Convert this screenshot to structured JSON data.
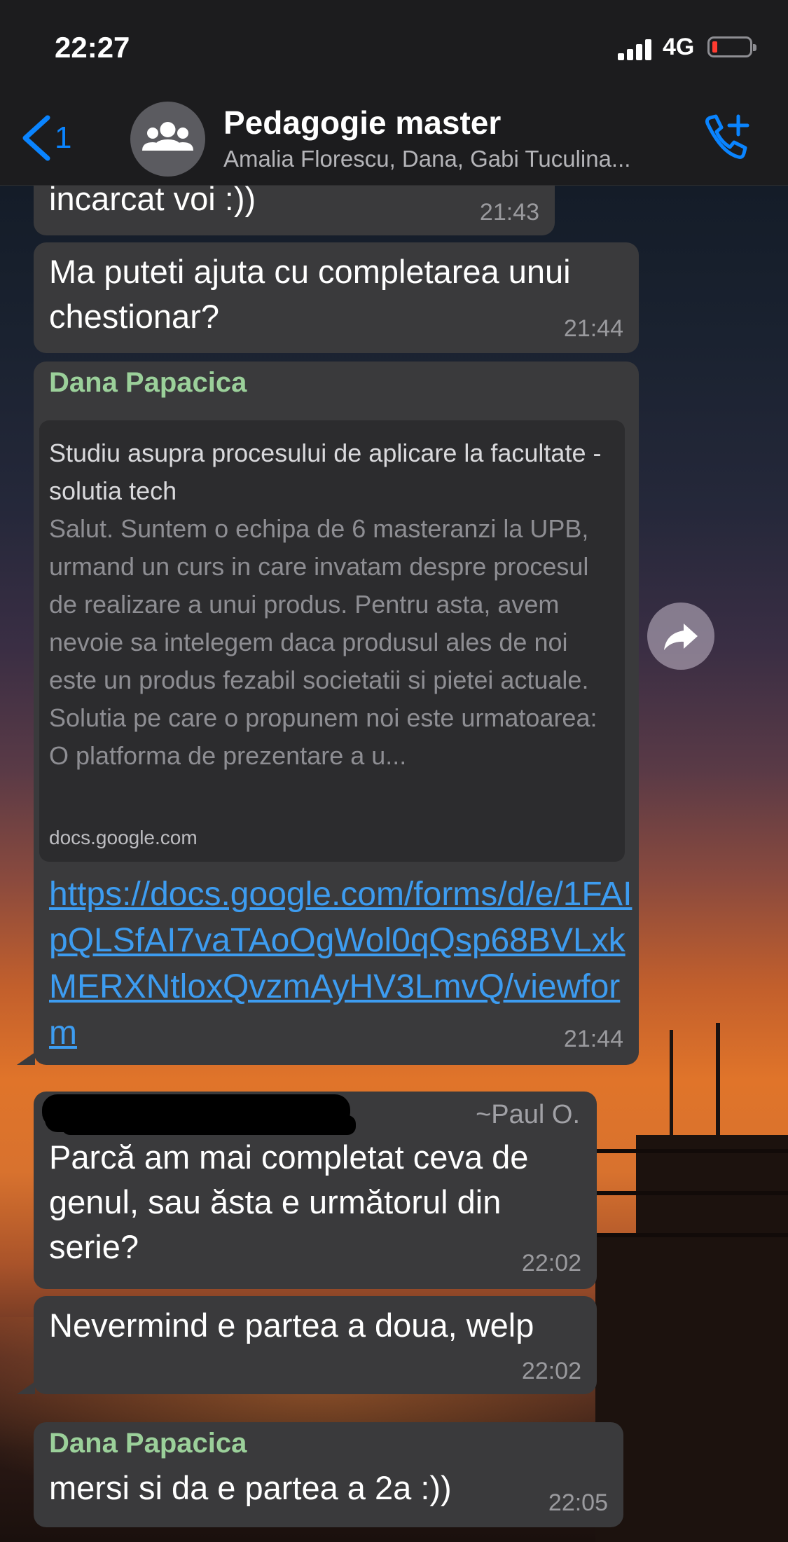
{
  "status_bar": {
    "time": "22:27",
    "network": "4G"
  },
  "header": {
    "back_count": "1",
    "title": "Pedagogie master",
    "subtitle": "Amalia Florescu, Dana, Gabi Tuculina..."
  },
  "messages": [
    {
      "text": "incarcat voi :))",
      "time": "21:43"
    },
    {
      "text": "Ma puteti ajuta cu completarea unui chestionar?",
      "time": "21:44"
    },
    {
      "sender": "Dana Papacica",
      "preview": {
        "title": "Studiu asupra procesului de aplicare la facultate - solutia tech",
        "description": "Salut. Suntem o echipa de 6 masteranzi la UPB, urmand un curs in care invatam despre procesul de realizare a unui produs. Pentru asta, avem nevoie sa intelegem daca produsul ales de noi este un produs fezabil societatii si pietei actuale. Solutia pe care o propunem noi este urmatoarea: O platforma de prezentare a u...",
        "domain": "docs.google.com"
      },
      "link": "https://docs.google.com/forms/d/e/1FAIpQLSfAI7vaTAoOgWol0qQsp68BVLxkMERXNtloxQvzmAyHV3LmvQ/viewform",
      "time": "21:44"
    },
    {
      "sender": "~Paul O.",
      "text": "Parcă am mai completat ceva de genul, sau ăsta e următorul din serie?",
      "time": "22:02"
    },
    {
      "text": "Nevermind e partea a doua, welp",
      "time": "22:02"
    },
    {
      "sender": "Dana Papacica",
      "text": "mersi si da e partea a 2a :))",
      "time": "22:05"
    }
  ],
  "colors": {
    "accent": "#0a84ff",
    "bubble": "#3a3a3c",
    "sender_green": "#9bd09a",
    "link": "#3d9cf0"
  }
}
